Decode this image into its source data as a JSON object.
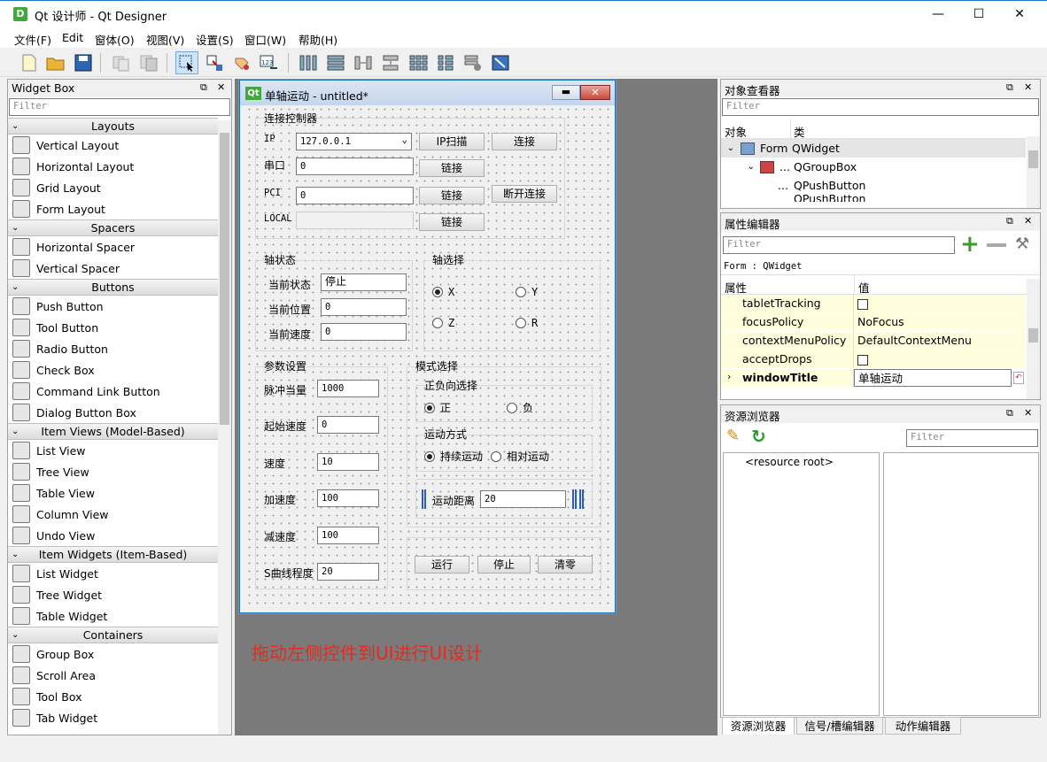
{
  "window": {
    "title": "Qt 设计师 - Qt Designer",
    "logo": "D",
    "min": "—",
    "max": "☐",
    "close": "✕"
  },
  "menubar": [
    "文件(F)",
    "Edit",
    "窗体(O)",
    "视图(V)",
    "设置(S)",
    "窗口(W)",
    "帮助(H)"
  ],
  "widgetbox": {
    "title": "Widget Box",
    "filter_placeholder": "Filter",
    "categories": [
      {
        "label": "Layouts",
        "items": [
          "Vertical Layout",
          "Horizontal Layout",
          "Grid Layout",
          "Form Layout"
        ]
      },
      {
        "label": "Spacers",
        "items": [
          "Horizontal Spacer",
          "Vertical Spacer"
        ]
      },
      {
        "label": "Buttons",
        "items": [
          "Push Button",
          "Tool Button",
          "Radio Button",
          "Check Box",
          "Command Link Button",
          "Dialog Button Box"
        ]
      },
      {
        "label": "Item Views (Model-Based)",
        "items": [
          "List View",
          "Tree View",
          "Table View",
          "Column View",
          "Undo View"
        ]
      },
      {
        "label": "Item Widgets (Item-Based)",
        "items": [
          "List Widget",
          "Tree Widget",
          "Table Widget"
        ]
      },
      {
        "label": "Containers",
        "items": [
          "Group Box",
          "Scroll Area",
          "Tool Box",
          "Tab Widget"
        ]
      }
    ]
  },
  "form": {
    "title": "单轴运动 - untitled*",
    "qt_logo": "Qt",
    "conn_group": "连接控制器",
    "ip_label": "IP",
    "ip_value": "127.0.0.1",
    "ip_scan": "IP扫描",
    "connect": "连接",
    "serial_label": "串口",
    "serial_value": "0",
    "link1": "链接",
    "pci_label": "PCI",
    "pci_value": "0",
    "link2": "链接",
    "disconnect": "断开连接",
    "local_label": "LOCAL",
    "link3": "链接",
    "axis_state_group": "轴状态",
    "cur_state_label": "当前状态",
    "cur_state_value": "停止",
    "cur_pos_label": "当前位置",
    "cur_pos_value": "0",
    "cur_speed_label": "当前速度",
    "cur_speed_value": "0",
    "axis_sel_group": "轴选择",
    "axes": [
      "X",
      "Y",
      "Z",
      "R"
    ],
    "param_group": "参数设置",
    "params": [
      {
        "label": "脉冲当量",
        "value": "1000"
      },
      {
        "label": "起始速度",
        "value": "0"
      },
      {
        "label": "速度",
        "value": "10"
      },
      {
        "label": "加速度",
        "value": "100"
      },
      {
        "label": "减速度",
        "value": "100"
      },
      {
        "label": "S曲线程度",
        "value": "20"
      }
    ],
    "mode_group": "模式选择",
    "dir_group": "正负向选择",
    "dir_pos": "正",
    "dir_neg": "负",
    "motion_group": "运动方式",
    "motion_cont": "持续运动",
    "motion_rel": "相对运动",
    "dist_label": "运动距离",
    "dist_value": "20",
    "run": "运行",
    "stop": "停止",
    "zero": "清零"
  },
  "hint": "拖动左侧控件到UI进行UI设计",
  "object_inspector": {
    "title": "对象查看器",
    "filter_placeholder": "Filter",
    "col_object": "对象",
    "col_class": "类",
    "rows": [
      {
        "name": "Form",
        "cls": "QWidget"
      },
      {
        "name": "...",
        "cls": "QGroupBox"
      },
      {
        "name": "...",
        "cls": "QPushButton"
      },
      {
        "name": "",
        "cls": "QPushButton"
      }
    ]
  },
  "property_editor": {
    "title": "属性编辑器",
    "filter_placeholder": "Filter",
    "context": "Form : QWidget",
    "col_prop": "属性",
    "col_val": "值",
    "rows": [
      {
        "name": "tabletTracking",
        "value": ""
      },
      {
        "name": "focusPolicy",
        "value": "NoFocus"
      },
      {
        "name": "contextMenuPolicy",
        "value": "DefaultContextMenu"
      },
      {
        "name": "acceptDrops",
        "value": ""
      },
      {
        "name": "windowTitle",
        "value": "单轴运动"
      }
    ]
  },
  "resource_browser": {
    "title": "资源浏览器",
    "filter_placeholder": "Filter",
    "root": "<resource root>"
  },
  "bottom_tabs": [
    "资源浏览器",
    "信号/槽编辑器",
    "动作编辑器"
  ],
  "colors": {
    "accent": "#1e6fb8",
    "hint": "#e8291c",
    "prop_bg": "#fffedc"
  }
}
